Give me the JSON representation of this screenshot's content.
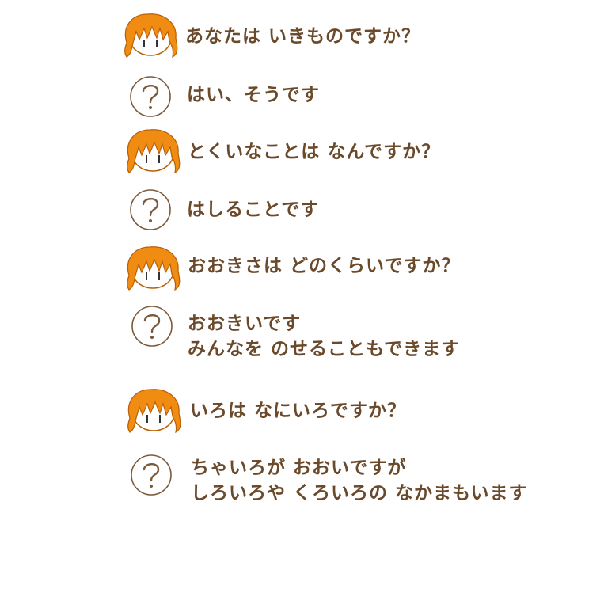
{
  "conversation": [
    {
      "speaker": "girl",
      "lines": [
        "あなたは いきものですか？"
      ]
    },
    {
      "speaker": "answer",
      "lines": [
        "はい、そうです"
      ]
    },
    {
      "speaker": "girl",
      "lines": [
        "とくいなことは なんですか？"
      ]
    },
    {
      "speaker": "answer",
      "lines": [
        "はしることです"
      ]
    },
    {
      "speaker": "girl",
      "lines": [
        "おおきさは どのくらいですか？"
      ]
    },
    {
      "speaker": "answer",
      "lines": [
        "おおきいです",
        "みんなを のせることもできます"
      ]
    },
    {
      "speaker": "girl",
      "lines": [
        "いろは なにいろですか？"
      ]
    },
    {
      "speaker": "answer",
      "lines": [
        "ちゃいろが おおいですが",
        "しろいろや くろいろの なかまもいます"
      ]
    }
  ],
  "icons": {
    "girl": "girl-face-icon",
    "answer": "question-mark-icon"
  },
  "colors": {
    "text": "#6b4a2b",
    "hair": "#f08c12",
    "hair_dark": "#b95f06",
    "circle": "#7a5a3c"
  }
}
